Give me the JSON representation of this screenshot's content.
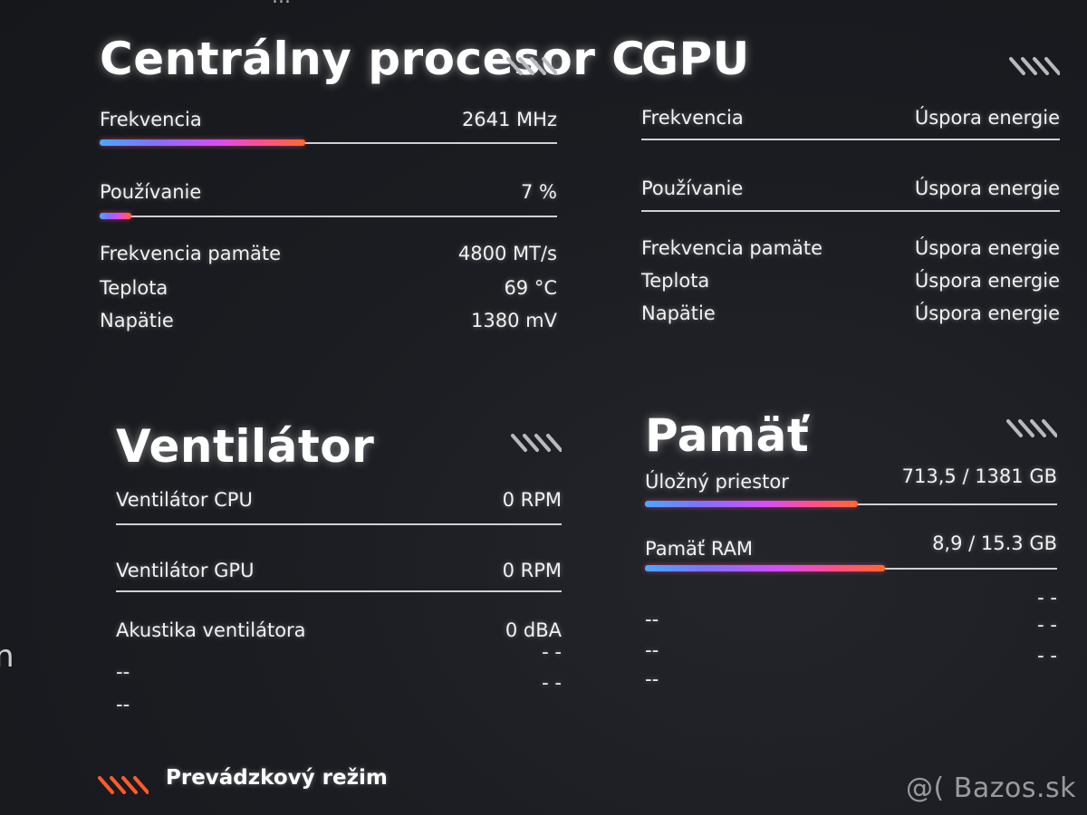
{
  "top_cut_text": "...",
  "left_edge_glyph": "n",
  "cpu": {
    "title": "Centrálny procesor C",
    "freq": {
      "label": "Frekvencia",
      "value": "2641 MHz",
      "fill_pct": 45
    },
    "usage": {
      "label": "Používanie",
      "value": "7 %",
      "fill_pct": 7
    },
    "stats": [
      {
        "label": "Frekvencia pamäte",
        "value": "4800 MT/s"
      },
      {
        "label": "Teplota",
        "value": "69 °C"
      },
      {
        "label": "Napätie",
        "value": "1380 mV"
      }
    ],
    "icon": "stripes-icon"
  },
  "gpu": {
    "title": "GPU",
    "freq": {
      "label": "Frekvencia",
      "value": "Úspora energie"
    },
    "usage": {
      "label": "Používanie",
      "value": "Úspora energie"
    },
    "stats": [
      {
        "label": "Frekvencia pamäte",
        "value": "Úspora energie"
      },
      {
        "label": "Teplota",
        "value": "Úspora energie"
      },
      {
        "label": "Napätie",
        "value": "Úspora energie"
      }
    ],
    "icon": "stripes-icon"
  },
  "fan": {
    "title": "Ventilátor",
    "cpu_fan": {
      "label": "Ventilátor CPU",
      "value": "0 RPM"
    },
    "gpu_fan": {
      "label": "Ventilátor GPU",
      "value": "0 RPM"
    },
    "acoustics": {
      "label": "Akustika ventilátora",
      "value": "0 dBA"
    },
    "extra": [
      {
        "label": "--",
        "value": "- -"
      },
      {
        "label": "--",
        "value": "- -"
      }
    ],
    "icon": "stripes-icon"
  },
  "memory": {
    "title": "Pamäť",
    "storage": {
      "label": "Úložný priestor",
      "value": "713,5 / 1381 GB",
      "fill_pct": 51.7
    },
    "ram": {
      "label": "Pamäť RAM",
      "value": "8,9 / 15.3 GB",
      "fill_pct": 58.2
    },
    "extra": [
      {
        "label": "",
        "value": "- -"
      },
      {
        "label": "--",
        "value": "- -"
      },
      {
        "label": "--",
        "value": "- -"
      },
      {
        "label": "--",
        "value": ""
      }
    ],
    "icon": "stripes-icon"
  },
  "footer": {
    "mode_label": "Prevádzkový režim",
    "mode_icon": "performance-stripes-icon",
    "mode_color": "#ff5a2b"
  },
  "watermark": "@( Bazos.sk"
}
